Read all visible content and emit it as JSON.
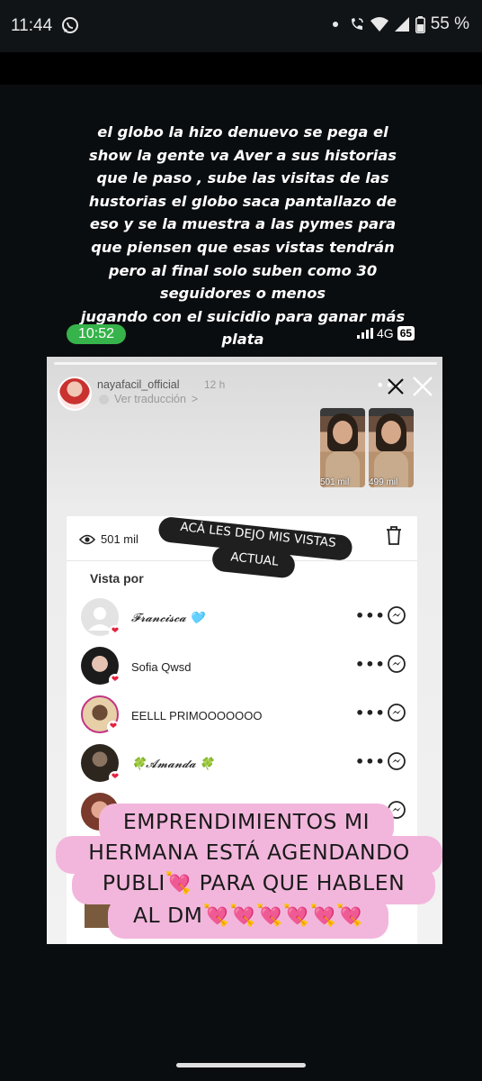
{
  "status_bar": {
    "time": "11:44",
    "battery": "55 %",
    "icons": [
      "whatsapp-icon",
      "notification-dot-icon",
      "wifi-call-icon",
      "wifi-icon",
      "signal-icon",
      "battery-icon"
    ]
  },
  "caption": {
    "lines": [
      "el globo la hizo denuevo se pega el",
      "show la gente va Aver a sus historias",
      "que le paso , sube las visitas de las",
      "hustorias el globo saca pantallazo de",
      "eso y se la muestra a las pymes para",
      "que piensen que esas vistas tendrán",
      "pero al final solo suben como 30",
      "seguidores o menos",
      "jugando con el suicidio para ganar más",
      "plata"
    ]
  },
  "inner_status": {
    "time": "10:52",
    "network": "4G",
    "battery": "65"
  },
  "story": {
    "username": "nayafacil_official",
    "age": "12 h",
    "translate": "Ver traducción",
    "translate_chevron": ">",
    "thumbnails": [
      {
        "views": "501 mil"
      },
      {
        "views": "499 mil"
      }
    ],
    "views": "501 mil",
    "viewed_by_label": "Vista por",
    "viewers": [
      {
        "name": "𝓕𝓻𝓪𝓷𝓬𝓲𝓼𝓬𝓪 🩵",
        "avatar": "#e3e3e3"
      },
      {
        "name": "Sofia Qwsd",
        "avatar": "#2a2a2a"
      },
      {
        "name": "EELLL PRIMOOOOOOO",
        "avatar": "#c59a6d"
      },
      {
        "name": "🍀𝓐𝓶𝓪𝓷𝓭𝓪 🍀",
        "avatar": "#3a3128"
      },
      {
        "name": "",
        "avatar": "#b86a55"
      }
    ]
  },
  "stickers": {
    "dark_line1": "ACÁ LES DEJO MIS VISTAS",
    "dark_line2": "ACTUAL",
    "pink_lines": [
      "EMPRENDIMIENTOS MI",
      "HERMANA ESTÁ AGENDANDO",
      "PUBLI💘 PARA QUE HABLEN",
      "AL DM💘💘💘💘💘💘"
    ]
  },
  "colors": {
    "background": "#0a0d10",
    "pink_sticker": "#f2b6dc",
    "inner_time_pill": "#36b34a",
    "like_heart": "#e4213c"
  }
}
